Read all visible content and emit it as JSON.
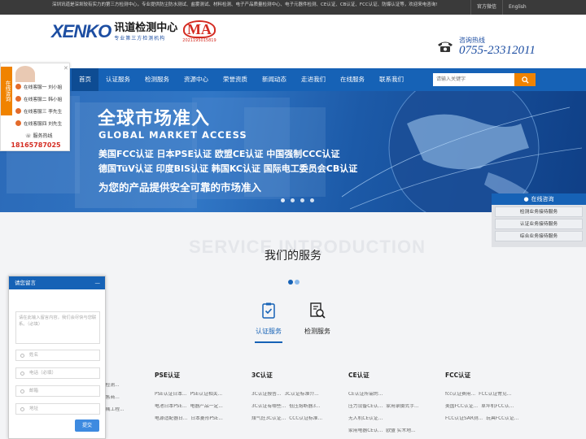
{
  "topbar": {
    "notice": "深圳讯道是深圳较有实力的第三方检测中心，专业提供防尘防水测试、盐雾测试、材料检测、电子产品质量检测中心、电子元器件检测、CE认证、CB认证、FCC认证、防爆认证等，欢迎来电咨询!",
    "links": [
      "官方微信",
      "English"
    ]
  },
  "header": {
    "logo_en": "XENKO",
    "logo_cn": "讯道检测中心",
    "logo_sub": "专业第三方检测机构",
    "ma_mark": "MA",
    "ma_number": "2021195015819",
    "hotline_label": "咨询热线",
    "hotline_number": "0755-23312011"
  },
  "nav": {
    "items": [
      "首页",
      "认证服务",
      "检测服务",
      "资源中心",
      "荣誉资质",
      "新闻动态",
      "走进我们",
      "在线服务",
      "联系我们"
    ],
    "search_placeholder": "请输入关键字"
  },
  "banner": {
    "title_cn": "全球市场准入",
    "title_en": "GLOBAL MARKET ACCESS",
    "line1": "美国FCC认证   日本PSE认证   欧盟CE认证   中国强制CCC认证",
    "line2": "德国TüV认证   印度BIS认证   韩国KC认证   国际电工委员会CB认证",
    "tagline": "为您的产品提供安全可靠的市场准入"
  },
  "service": {
    "bg_text": "SERVICE INTRODUCTION",
    "title": "我们的服务",
    "tabs": [
      "认证服务",
      "检测服务"
    ],
    "columns": [
      {
        "heading": "",
        "rows": [
          [
            "的电源检测...",
            ""
          ],
          [
            "SAA销售商...",
            ""
          ],
          [
            "SAA机械工程...",
            ""
          ]
        ]
      },
      {
        "heading": "PSE认证",
        "rows": [
          [
            "PSE认证日本...",
            "PSE认证相关..."
          ],
          [
            "电池日本PSE...",
            "电器产品一定..."
          ],
          [
            "电源适配器日...",
            "日本菱形PSE..."
          ]
        ]
      },
      {
        "heading": "3C认证",
        "rows": [
          [
            "3C认证报告...",
            "3C认证标准介..."
          ],
          [
            "3C认证有哪些...",
            "低压熔断器3..."
          ],
          [
            "煤气灶3C认证...",
            "CCC认证标准..."
          ]
        ]
      },
      {
        "heading": "CE认证",
        "rows": [
          [
            "CE认证所需的...",
            ""
          ],
          [
            "压力设备CE认...",
            "家用录摄式手..."
          ],
          [
            "无人机CE认证...",
            ""
          ],
          [
            "家用电器CE认...",
            "欧盟 实木地..."
          ]
        ]
      },
      {
        "heading": "FCC认证",
        "rows": [
          [
            "fcc认证费用...",
            "FCC认证常见..."
          ],
          [
            "美国FCC认证...",
            "草坪机FCC认..."
          ],
          [
            "FCC认证SAR测...",
            "玩具FCC认证..."
          ]
        ]
      }
    ]
  },
  "left_chat": {
    "tag": "在线咨询",
    "agents": [
      "在线客服一 刘小姐",
      "在线客服二 韩小姐",
      "在线客服三 李先生",
      "在线客服四 刘先生"
    ],
    "hotline_label": "服务热线",
    "hotline_number": "18165787025"
  },
  "right_chat": {
    "header": "在线咨询",
    "items": [
      "检测业务接待服务",
      "认证业务接待服务",
      "综合业务接待服务"
    ]
  },
  "message": {
    "title": "请您留言",
    "textarea_placeholder": "请在此输入留言内容，我们会尽快与您联系。（必填）",
    "fields": [
      "姓名",
      "电话（必填）",
      "邮箱",
      "地址"
    ],
    "submit": "提交"
  },
  "colors": {
    "brand_blue": "#1662b6",
    "accent_orange": "#f08300",
    "logo_red": "#d42c22"
  }
}
